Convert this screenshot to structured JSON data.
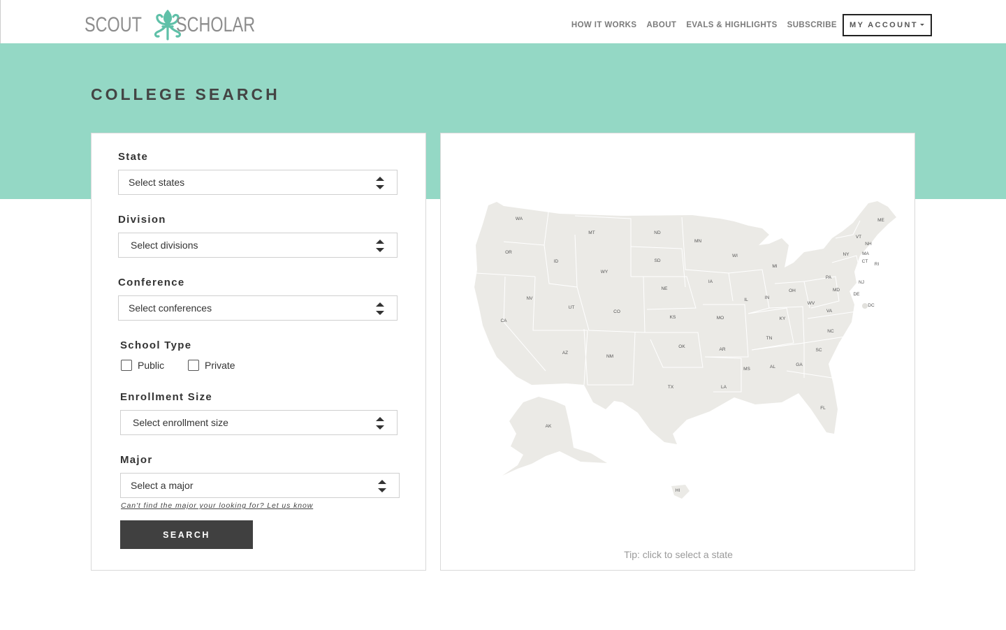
{
  "brand": {
    "left_word": "SCOUT",
    "right_word": "SCHOLAR",
    "accent_color": "#5fc0a8",
    "logo_color": "#8d8d8d"
  },
  "nav": {
    "items": [
      "HOW IT WORKS",
      "ABOUT",
      "EVALS & HIGHLIGHTS",
      "SUBSCRIBE"
    ],
    "account_label": "MY ACCOUNT"
  },
  "hero": {
    "background": "#94d8c5",
    "title": "COLLEGE SEARCH"
  },
  "filters": {
    "state": {
      "label": "State",
      "value": "Select states"
    },
    "division": {
      "label": "Division",
      "value": "Select divisions"
    },
    "conference": {
      "label": "Conference",
      "value": "Select conferences"
    },
    "school_type": {
      "label": "School Type",
      "public_label": "Public",
      "private_label": "Private",
      "public_checked": false,
      "private_checked": false
    },
    "enrollment": {
      "label": "Enrollment Size",
      "value": "Select enrollment size"
    },
    "major": {
      "label": "Major",
      "value": "Select a major"
    },
    "help_link": "Can't find the major your looking for? Let us know",
    "search_button": "SEARCH"
  },
  "map": {
    "fill_color": "#ebeae6",
    "state_labels": [
      "WA",
      "OR",
      "CA",
      "NV",
      "ID",
      "MT",
      "WY",
      "UT",
      "AZ",
      "NM",
      "CO",
      "ND",
      "SD",
      "NE",
      "KS",
      "OK",
      "TX",
      "MN",
      "IA",
      "MO",
      "AR",
      "LA",
      "WI",
      "IL",
      "MI",
      "IN",
      "OH",
      "KY",
      "TN",
      "MS",
      "AL",
      "GA",
      "FL",
      "SC",
      "NC",
      "VA",
      "WV",
      "PA",
      "NY",
      "MD",
      "DE",
      "NJ",
      "CT",
      "RI",
      "MA",
      "VT",
      "NH",
      "ME",
      "DC",
      "AK",
      "HI"
    ],
    "tip": "Tip: click to select a state"
  }
}
